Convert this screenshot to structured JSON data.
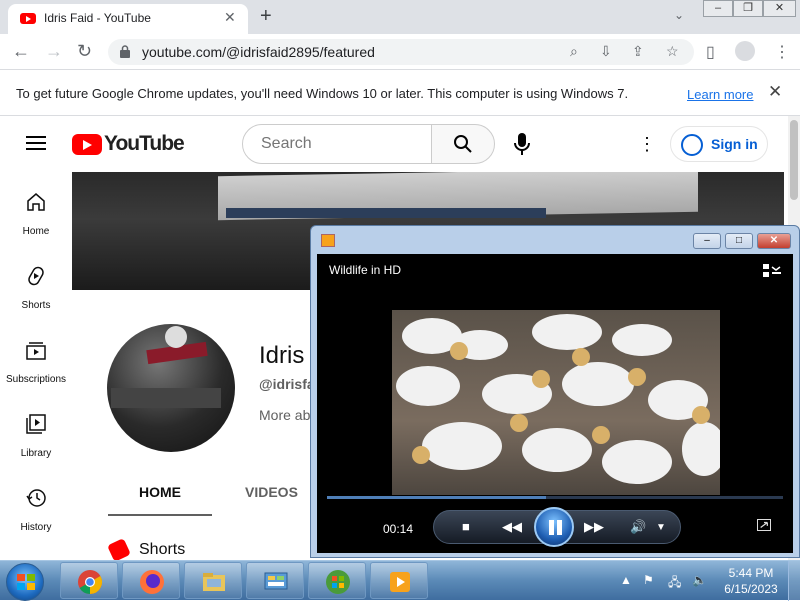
{
  "browser": {
    "tab_title": "Idris Faid - YouTube",
    "url": "youtube.com/@idrisfaid2895/featured",
    "infobar_message": "To get future Google Chrome updates, you'll need Windows 10 or later. This computer is using Windows 7.",
    "infobar_link": "Learn more"
  },
  "youtube": {
    "logo_text": "YouTube",
    "search_placeholder": "Search",
    "signin_label": "Sign in",
    "nav": [
      {
        "label": "Home",
        "icon": "home-icon"
      },
      {
        "label": "Shorts",
        "icon": "shorts-icon"
      },
      {
        "label": "Subscriptions",
        "icon": "subscriptions-icon"
      },
      {
        "label": "Library",
        "icon": "library-icon"
      },
      {
        "label": "History",
        "icon": "history-icon"
      }
    ],
    "channel": {
      "name": "Idris",
      "handle": "@idrisfai",
      "more": "More ab"
    },
    "tabs": [
      "HOME",
      "VIDEOS"
    ],
    "section_title": "Shorts"
  },
  "media_player": {
    "title": "Wildlife in HD",
    "timecode": "00:14",
    "progress": 0.48
  },
  "taskbar": {
    "time": "5:44 PM",
    "date": "6/15/2023"
  }
}
